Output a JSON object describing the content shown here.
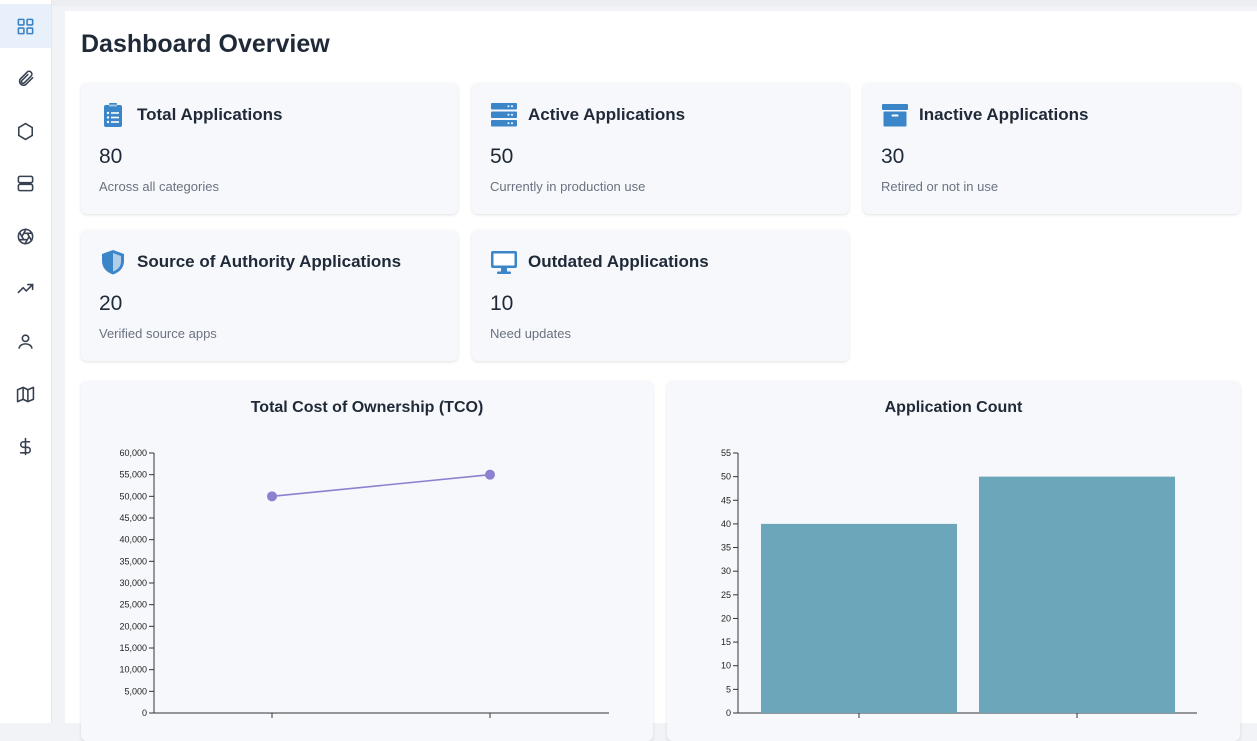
{
  "sidebar": {
    "items": [
      {
        "icon": "grid-icon",
        "active": true
      },
      {
        "icon": "paperclip-icon"
      },
      {
        "icon": "hexagon-icon"
      },
      {
        "icon": "server-icon"
      },
      {
        "icon": "aperture-icon"
      },
      {
        "icon": "trending-up-icon"
      },
      {
        "icon": "user-icon"
      },
      {
        "icon": "map-icon"
      },
      {
        "icon": "dollar-icon"
      }
    ]
  },
  "page": {
    "title": "Dashboard Overview"
  },
  "cards": [
    {
      "title": "Total Applications",
      "value": "80",
      "subtitle": "Across all categories",
      "icon": "clipboard-list-icon"
    },
    {
      "title": "Active Applications",
      "value": "50",
      "subtitle": "Currently in production use",
      "icon": "server-stack-icon"
    },
    {
      "title": "Inactive Applications",
      "value": "30",
      "subtitle": "Retired or not in use",
      "icon": "archive-icon"
    },
    {
      "title": "Source of Authority Applications",
      "value": "20",
      "subtitle": "Verified source apps",
      "icon": "shield-icon"
    },
    {
      "title": "Outdated Applications",
      "value": "10",
      "subtitle": "Need updates",
      "icon": "monitor-icon"
    }
  ],
  "colors": {
    "accent": "#3b86c9",
    "line": "#8a82d1",
    "bar": "#6ba6ba"
  },
  "chart_data": [
    {
      "type": "line",
      "title": "Total Cost of Ownership (TCO)",
      "y_ticks": [
        "0",
        "5,000",
        "10,000",
        "15,000",
        "20,000",
        "25,000",
        "30,000",
        "35,000",
        "40,000",
        "45,000",
        "50,000",
        "55,000",
        "60,000"
      ],
      "ylim": [
        0,
        60000
      ],
      "values": [
        50000,
        55000
      ],
      "color": "#8a82d1"
    },
    {
      "type": "bar",
      "title": "Application Count",
      "y_ticks": [
        "0",
        "5",
        "10",
        "15",
        "20",
        "25",
        "30",
        "35",
        "40",
        "45",
        "50",
        "55"
      ],
      "ylim": [
        0,
        55
      ],
      "values": [
        40,
        50
      ],
      "color": "#6ba6ba"
    }
  ]
}
